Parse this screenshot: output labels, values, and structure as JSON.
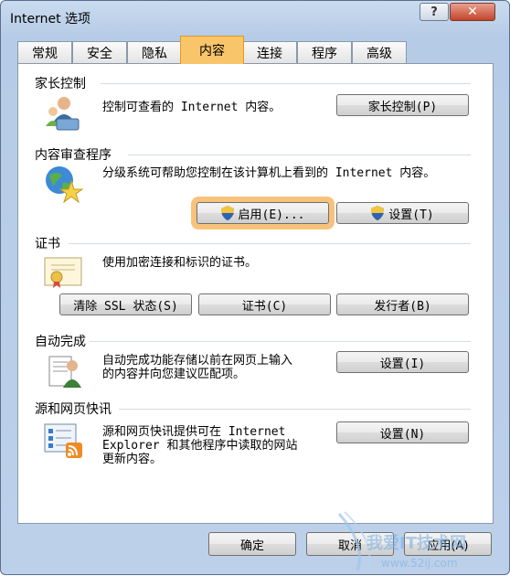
{
  "window": {
    "title": "Internet 选项",
    "help": "?",
    "close": "✕"
  },
  "tabs": [
    {
      "label": "常规"
    },
    {
      "label": "安全"
    },
    {
      "label": "隐私"
    },
    {
      "label": "内容",
      "active": true
    },
    {
      "label": "连接"
    },
    {
      "label": "程序"
    },
    {
      "label": "高级"
    }
  ],
  "parental": {
    "title": "家长控制",
    "desc": "控制可查看的 Internet 内容。",
    "button": "家长控制(P)"
  },
  "advisor": {
    "title": "内容审查程序",
    "desc": "分级系统可帮助您控制在该计算机上看到的 Internet 内容。",
    "enable_button": "启用(E)...",
    "settings_button": "设置(T)"
  },
  "certificates": {
    "title": "证书",
    "desc": "使用加密连接和标识的证书。",
    "clear_ssl_button": "清除 SSL 状态(S)",
    "certs_button": "证书(C)",
    "publishers_button": "发行者(B)"
  },
  "autocomplete": {
    "title": "自动完成",
    "desc_line1": "自动完成功能存储以前在网页上输入",
    "desc_line2": "的内容并向您建议匹配项。",
    "settings_button": "设置(I)"
  },
  "feeds": {
    "title": "源和网页快讯",
    "desc_line1": "源和网页快讯提供可在 Internet",
    "desc_line2": "Explorer 和其他程序中读取的网站",
    "desc_line3": "更新内容。",
    "settings_button": "设置(N)"
  },
  "footer": {
    "ok": "确定",
    "cancel": "取消",
    "apply": "应用(A)"
  },
  "watermark": {
    "text": "我爱IT技术网",
    "url": "www.52ij.com"
  },
  "colors": {
    "highlight": "#f8c27a",
    "active_tab": "#f9c56a",
    "dialog_bg": "#bcd0ea"
  }
}
